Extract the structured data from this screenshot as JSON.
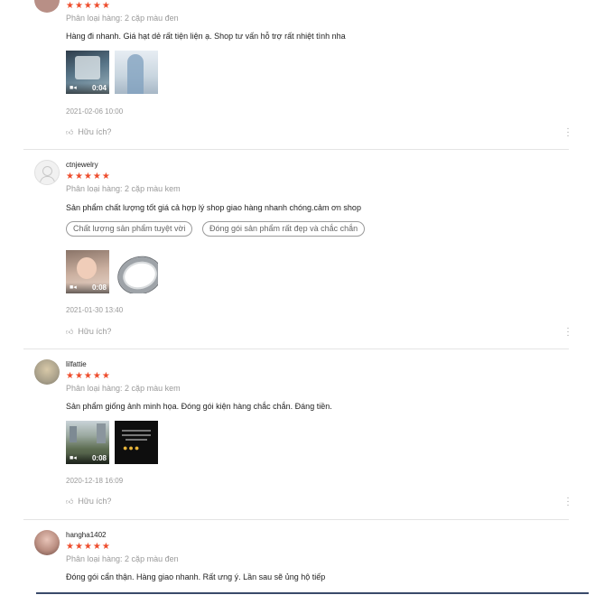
{
  "reviews": [
    {
      "username": "",
      "stars": "★★★★★",
      "variant": "Phân loại hàng: 2 cặp màu đen",
      "content": "Hàng đi nhanh. Giá hạt dẻ rất tiện liện ạ. Shop tư vấn hỗ trợ rất nhiệt tình nha",
      "tags": [],
      "video_duration": "0:04",
      "time": "2021-02-06 10:00",
      "helpful_label": "Hữu ích?"
    },
    {
      "username": "ctnjewelry",
      "stars": "★★★★★",
      "variant": "Phân loại hàng: 2 cặp màu kem",
      "content": "Sản phẩm chất lượng tốt giá cả hợp lý shop giao hàng nhanh chóng.cảm ơn shop",
      "tags": [
        "Chất lượng sản phẩm tuyệt vời",
        "Đóng gói sản phẩm rất đẹp và chắc chắn"
      ],
      "video_duration": "0:08",
      "time": "2021-01-30 13:40",
      "helpful_label": "Hữu ích?"
    },
    {
      "username": "lilfattie",
      "stars": "★★★★★",
      "variant": "Phân loại hàng: 2 cặp màu kem",
      "content": "Sản phẩm giống ảnh minh họa. Đóng gói kiện hàng chắc chắn. Đáng tiền.",
      "tags": [],
      "video_duration": "0:08",
      "time": "2020-12-18 16:09",
      "helpful_label": "Hữu ích?"
    },
    {
      "username": "hangha1402",
      "stars": "★★★★★",
      "variant": "Phân loại hàng: 2 cặp màu đen",
      "content": "Đóng gói cẩn thận. Hàng giao nhanh. Rất ưng ý. Lần sau sẽ ủng hộ tiếp",
      "tags": [],
      "video_duration": "",
      "time": "",
      "helpful_label": ""
    }
  ],
  "icons": {
    "thumb": "thumbs-up-icon",
    "more": "more-vertical-icon",
    "camera": "video-camera-icon"
  },
  "colors": {
    "star": "#ee4d2d",
    "muted": "#9a9a9a",
    "divider": "#e4e4e4"
  }
}
